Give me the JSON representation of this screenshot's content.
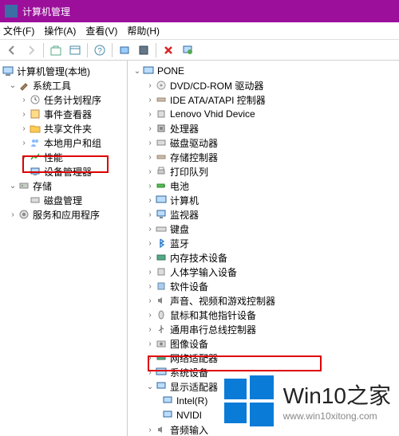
{
  "title": "计算机管理",
  "menu": {
    "file": "文件(F)",
    "action": "操作(A)",
    "view": "查看(V)",
    "help": "帮助(H)"
  },
  "left": {
    "root": "计算机管理(本地)",
    "sys_tools": "系统工具",
    "task": "任务计划程序",
    "event": "事件查看器",
    "shared": "共享文件夹",
    "users": "本地用户和组",
    "perf": "性能",
    "devmgr": "设备管理器",
    "storage": "存储",
    "disk": "磁盘管理",
    "services": "服务和应用程序"
  },
  "right": {
    "root": "PONE",
    "dvd": "DVD/CD-ROM 驱动器",
    "ide": "IDE ATA/ATAPI 控制器",
    "lenovo": "Lenovo Vhid Device",
    "cpu": "处理器",
    "diskdrv": "磁盘驱动器",
    "storectl": "存储控制器",
    "printq": "打印队列",
    "battery": "电池",
    "computer": "计算机",
    "monitor": "监视器",
    "keyboard": "键盘",
    "bluetooth": "蓝牙",
    "memtech": "内存技术设备",
    "hid": "人体学输入设备",
    "software": "软件设备",
    "sound": "声音、视频和游戏控制器",
    "mouse": "鼠标和其他指针设备",
    "usb": "通用串行总线控制器",
    "image": "图像设备",
    "network": "网络适配器",
    "system": "系统设备",
    "display": "显示适配器",
    "intel": "Intel(R)",
    "nvidia": "NVIDI",
    "audio": "音频输入"
  },
  "watermark": {
    "title": "Win10之家",
    "url": "www.win10xitong.com"
  }
}
